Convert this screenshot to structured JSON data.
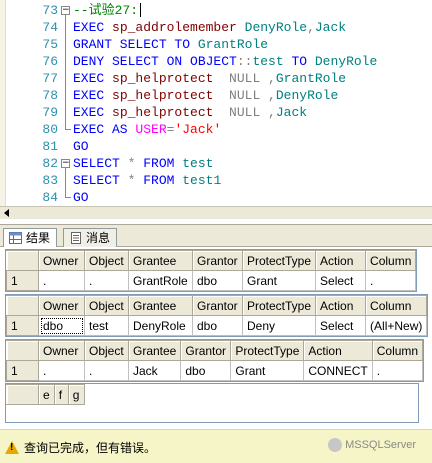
{
  "editor": {
    "lines": [
      {
        "num": "73",
        "html_parts": [
          [
            "cm",
            "--试验27:"
          ]
        ]
      },
      {
        "num": "74",
        "html_parts": [
          [
            "kw",
            "EXEC "
          ],
          [
            "sp",
            "sp_addrolemember "
          ],
          [
            "id",
            "DenyRole"
          ],
          [
            "gr",
            ","
          ],
          [
            "id",
            "Jack"
          ]
        ]
      },
      {
        "num": "75",
        "html_parts": [
          [
            "kw",
            "GRANT SELECT TO "
          ],
          [
            "id",
            "GrantRole"
          ]
        ]
      },
      {
        "num": "76",
        "html_parts": [
          [
            "kw",
            "DENY SELECT ON OBJECT"
          ],
          [
            "gr",
            "::"
          ],
          [
            "id",
            "test "
          ],
          [
            "kw",
            "TO "
          ],
          [
            "id",
            "DenyRole"
          ]
        ]
      },
      {
        "num": "77",
        "html_parts": [
          [
            "kw",
            "EXEC "
          ],
          [
            "sp",
            "sp_helprotect  "
          ],
          [
            "gr",
            "NULL ,"
          ],
          [
            "id",
            "GrantRole"
          ]
        ]
      },
      {
        "num": "78",
        "html_parts": [
          [
            "kw",
            "EXEC "
          ],
          [
            "sp",
            "sp_helprotect  "
          ],
          [
            "gr",
            "NULL ,"
          ],
          [
            "id",
            "DenyRole"
          ]
        ]
      },
      {
        "num": "79",
        "html_parts": [
          [
            "kw",
            "EXEC "
          ],
          [
            "sp",
            "sp_helprotect  "
          ],
          [
            "gr",
            "NULL ,"
          ],
          [
            "id",
            "Jack"
          ]
        ]
      },
      {
        "num": "80",
        "html_parts": [
          [
            "kw",
            "EXEC AS "
          ],
          [
            "fn",
            "USER"
          ],
          [
            "gr",
            "="
          ],
          [
            "st",
            "'Jack'"
          ]
        ]
      },
      {
        "num": "81",
        "html_parts": [
          [
            "kw",
            "GO"
          ]
        ]
      },
      {
        "num": "82",
        "html_parts": [
          [
            "kw",
            "SELECT "
          ],
          [
            "gr",
            "* "
          ],
          [
            "kw",
            "FROM "
          ],
          [
            "id",
            "test"
          ]
        ]
      },
      {
        "num": "83",
        "html_parts": [
          [
            "kw",
            "SELECT "
          ],
          [
            "gr",
            "* "
          ],
          [
            "kw",
            "FROM "
          ],
          [
            "id",
            "test1"
          ]
        ]
      },
      {
        "num": "84",
        "html_parts": [
          [
            "kw",
            "GO"
          ]
        ]
      }
    ]
  },
  "tabs": {
    "results": "结果",
    "messages": "消息"
  },
  "grids": [
    {
      "headers": [
        "Owner",
        "Object",
        "Grantee",
        "Grantor",
        "ProtectType",
        "Action",
        "Column"
      ],
      "rows": [
        [
          "1",
          ".",
          ".",
          "GrantRole",
          "dbo",
          "Grant",
          "Select",
          "."
        ]
      ]
    },
    {
      "headers": [
        "Owner",
        "Object",
        "Grantee",
        "Grantor",
        "ProtectType",
        "Action",
        "Column"
      ],
      "rows": [
        [
          "1",
          "dbo",
          "test",
          "DenyRole",
          "dbo",
          "Deny",
          "Select",
          "(All+New)"
        ]
      ]
    },
    {
      "headers": [
        "Owner",
        "Object",
        "Grantee",
        "Grantor",
        "ProtectType",
        "Action",
        "Column"
      ],
      "rows": [
        [
          "1",
          ".",
          ".",
          "Jack",
          "dbo",
          "Grant",
          "CONNECT",
          "."
        ]
      ]
    },
    {
      "headers": [
        "e",
        "f",
        "g"
      ],
      "rows": []
    }
  ],
  "status": {
    "text": "查询已完成，但有错误。",
    "watermark": "MSSQLServer"
  }
}
